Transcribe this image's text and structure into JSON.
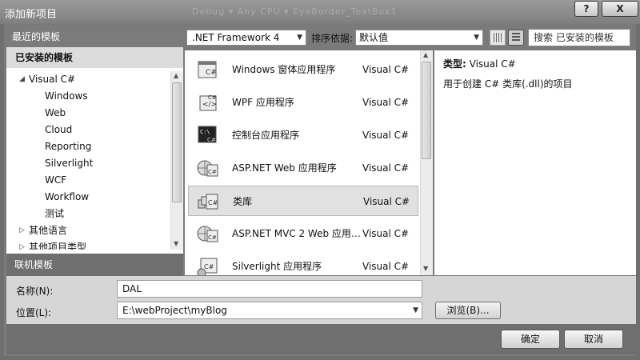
{
  "window": {
    "title": "添加新项目",
    "background_ghost_text": "Debug  ▾  Any CPU  ▾  EyeBorder_TextBox1",
    "help_label": "?",
    "close_label": "X"
  },
  "left_panel": {
    "recent_header": "最近的模板",
    "installed_header": "已安装的模板",
    "tree": [
      {
        "label": "Visual C#",
        "expanded": true
      },
      {
        "label": "Windows"
      },
      {
        "label": "Web"
      },
      {
        "label": "Cloud"
      },
      {
        "label": "Reporting"
      },
      {
        "label": "Silverlight"
      },
      {
        "label": "WCF"
      },
      {
        "label": "Workflow"
      },
      {
        "label": "测试"
      },
      {
        "label": "其他语言",
        "expanded": false
      },
      {
        "label": "其他项目类型",
        "expanded": false
      }
    ],
    "online_header": "联机模板"
  },
  "toolbar": {
    "framework": ".NET Framework 4",
    "sort_label": "排序依据:",
    "sort_value": "默认值",
    "search_placeholder": "搜索 已安装的模板"
  },
  "templates": [
    {
      "name": "Windows 窗体应用程序",
      "language": "Visual C#",
      "icon": "windows-forms-icon"
    },
    {
      "name": "WPF 应用程序",
      "language": "Visual C#",
      "icon": "wpf-icon"
    },
    {
      "name": "控制台应用程序",
      "language": "Visual C#",
      "icon": "console-icon"
    },
    {
      "name": "ASP.NET Web 应用程序",
      "language": "Visual C#",
      "icon": "web-app-icon"
    },
    {
      "name": "类库",
      "language": "Visual C#",
      "icon": "class-library-icon",
      "selected": true
    },
    {
      "name": "ASP.NET MVC 2 Web 应用…",
      "language": "Visual C#",
      "icon": "mvc-icon"
    },
    {
      "name": "Silverlight 应用程序",
      "language": "Visual C#",
      "icon": "silverlight-icon"
    }
  ],
  "details": {
    "type_label": "类型:",
    "type_value": "Visual C#",
    "description": "用于创建 C# 类库(.dll)的项目"
  },
  "form": {
    "name_label": "名称(N):",
    "name_value": "DAL",
    "location_label": "位置(L):",
    "location_value": "E:\\webProject\\myBlog",
    "browse_label": "浏览(B)..."
  },
  "buttons": {
    "ok": "确定",
    "cancel": "取消"
  }
}
